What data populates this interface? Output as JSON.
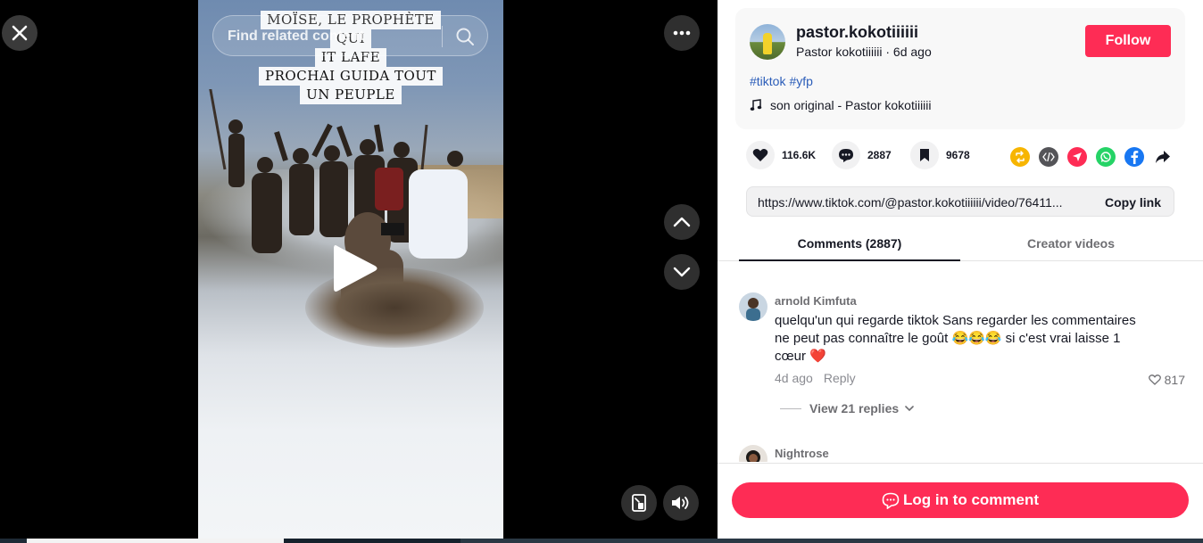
{
  "video": {
    "search_placeholder": "Find related content",
    "caption_lines": [
      "MOÏSE, LE PROPHÈTE",
      "QUI",
      "IT LAFE",
      "PROCHAI GUIDA TOUT",
      "UN PEUPLE"
    ],
    "icons": {
      "close": "close-icon",
      "more": "more-icon",
      "up": "chevron-up-icon",
      "down": "chevron-down-icon",
      "play": "play-icon",
      "pip": "picture-in-picture-icon",
      "volume": "volume-icon",
      "search": "search-icon"
    }
  },
  "author": {
    "username": "pastor.kokotiiiiii",
    "subtitle": "Pastor kokotiiiiii · 6d ago",
    "follow_label": "Follow"
  },
  "tags": [
    "#tiktok",
    "#yfp"
  ],
  "music": "son original - Pastor kokotiiiiii",
  "actions": {
    "likes": "116.6K",
    "comments": "2887",
    "saves": "9678"
  },
  "share_targets": [
    {
      "name": "repost-icon",
      "color": "#f7b500"
    },
    {
      "name": "embed-icon",
      "color": "#545458"
    },
    {
      "name": "send-icon",
      "color": "#fe2c55"
    },
    {
      "name": "whatsapp-icon",
      "color": "#25d366"
    },
    {
      "name": "facebook-icon",
      "color": "#1877f2"
    },
    {
      "name": "share-arrow-icon",
      "color": "#161823"
    }
  ],
  "link": {
    "url": "https://www.tiktok.com/@pastor.kokotiiiiii/video/76411...",
    "copy_label": "Copy link"
  },
  "tabs": {
    "comments": "Comments (2887)",
    "creator": "Creator videos"
  },
  "comments": [
    {
      "user": "arnold Kimfuta",
      "text": "quelqu'un qui regarde tiktok Sans regarder les commentaires ne peut pas connaître le goût 😂😂😂 si c'est vrai laisse 1 cœur ❤️",
      "time": "4d ago",
      "reply_label": "Reply",
      "likes": "817",
      "view_replies": "View 21 replies"
    },
    {
      "user": "Nightrose"
    }
  ],
  "login": {
    "label": "Log in to comment"
  },
  "colors": {
    "accent": "#fe2c55",
    "hashtag": "#2b5db9"
  }
}
